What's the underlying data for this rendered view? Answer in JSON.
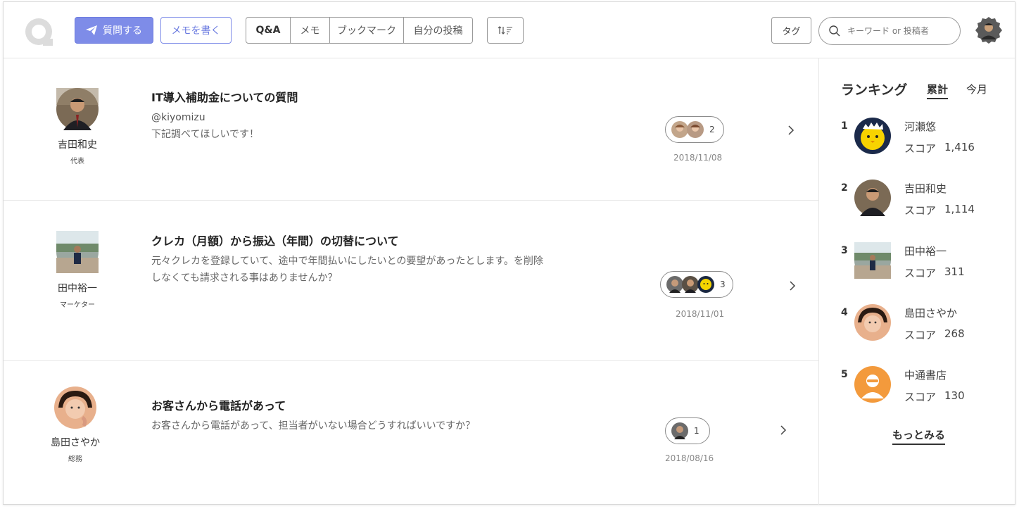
{
  "header": {
    "ask_label": "質問する",
    "memo_label": "メモを書く",
    "segments": [
      "Q&A",
      "メモ",
      "ブックマーク",
      "自分の投稿"
    ],
    "sort_label": "↑↓≡",
    "tag_label": "タグ",
    "search_placeholder": "キーワード or 投稿者",
    "accent_color": "#7e8ce8"
  },
  "posts": [
    {
      "author": "吉田和史",
      "role": "代表",
      "title": "IT導入補助金についての質問",
      "handle": "@kiyomizu",
      "body": "下記調べてほしいです！",
      "answer_count": "2",
      "date": "2018/11/08"
    },
    {
      "author": "田中裕一",
      "role": "マーケター",
      "title": "クレカ（月額）から振込（年間）の切替について",
      "body": "元々クレカを登録していて、途中で年間払いにしたいとの要望があったとします。を削除しなくても請求される事はありませんか？",
      "answer_count": "3",
      "date": "2018/11/01"
    },
    {
      "author": "島田さやか",
      "role": "総務",
      "title": "お客さんから電話があって",
      "body": "お客さんから電話があって、担当者がいない場合どうすればいいですか？",
      "answer_count": "1",
      "date": "2018/08/16"
    }
  ],
  "sidebar": {
    "title": "ランキング",
    "tab_total": "累計",
    "tab_month": "今月",
    "score_label": "スコア",
    "ranking": [
      {
        "rank": "1",
        "name": "河瀬悠",
        "score": "1,416"
      },
      {
        "rank": "2",
        "name": "吉田和史",
        "score": "1,114"
      },
      {
        "rank": "3",
        "name": "田中裕一",
        "score": "311"
      },
      {
        "rank": "4",
        "name": "島田さやか",
        "score": "268"
      },
      {
        "rank": "5",
        "name": "中通書店",
        "score": "130"
      }
    ],
    "more_label": "もっとみる"
  }
}
